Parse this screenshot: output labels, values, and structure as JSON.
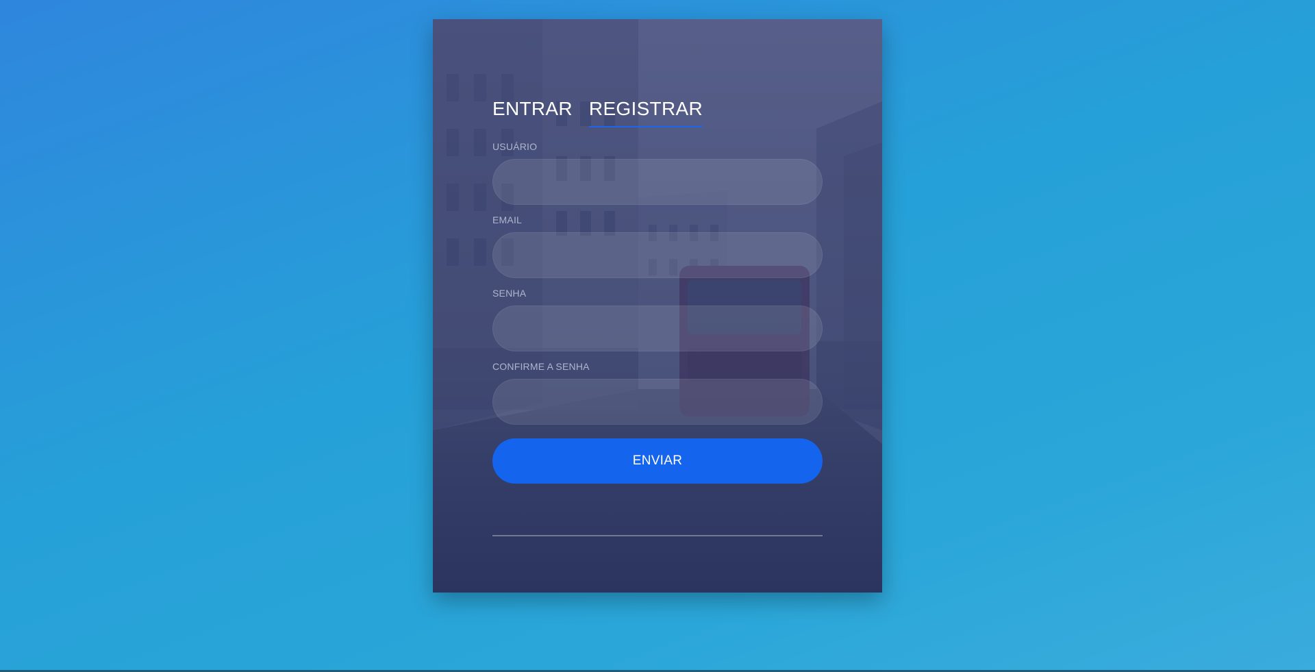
{
  "tabs": {
    "login": "ENTRAR",
    "register": "REGISTRAR"
  },
  "fields": {
    "username": {
      "label": "USUÁRIO",
      "value": "",
      "placeholder": ""
    },
    "email": {
      "label": "EMAIL",
      "value": "",
      "placeholder": ""
    },
    "password": {
      "label": "SENHA",
      "value": "",
      "placeholder": ""
    },
    "confirm_password": {
      "label": "CONFIRME A SENHA",
      "value": "",
      "placeholder": ""
    }
  },
  "submit_label": "ENVIAR",
  "colors": {
    "accent": "#1564ee",
    "tab_underline": "#1c67e8",
    "card_overlay": "#3b4a78"
  }
}
